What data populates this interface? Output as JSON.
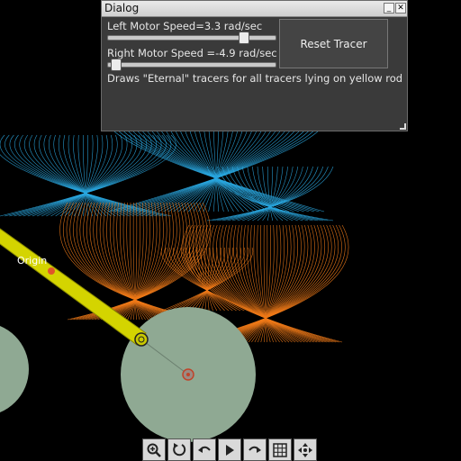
{
  "dialog": {
    "title": "Dialog",
    "minimize_glyph": "_",
    "close_glyph": "✕",
    "left_motor_label": "Left Motor Speed=3.3 rad/sec",
    "left_motor_value": 3.3,
    "right_motor_label": "Right Motor Speed =-4.9 rad/sec",
    "right_motor_value": -4.9,
    "reset_button": "Reset Tracer",
    "description": "Draws \"Eternal\" tracers for all tracers lying on yellow rod"
  },
  "scene": {
    "origin_label": "Origin",
    "colors": {
      "background": "#000000",
      "wheel_fill": "#8fa993",
      "rod": "#d4d400",
      "tracer_blue": "#2aa7e0",
      "tracer_orange": "#f07a18",
      "origin_dot": "#e0552a"
    }
  },
  "toolbar": {
    "buttons": [
      {
        "name": "zoom-icon"
      },
      {
        "name": "rotate-icon"
      },
      {
        "name": "undo-icon"
      },
      {
        "name": "play-icon"
      },
      {
        "name": "redo-icon"
      },
      {
        "name": "grid-icon"
      },
      {
        "name": "move-icon"
      }
    ]
  }
}
